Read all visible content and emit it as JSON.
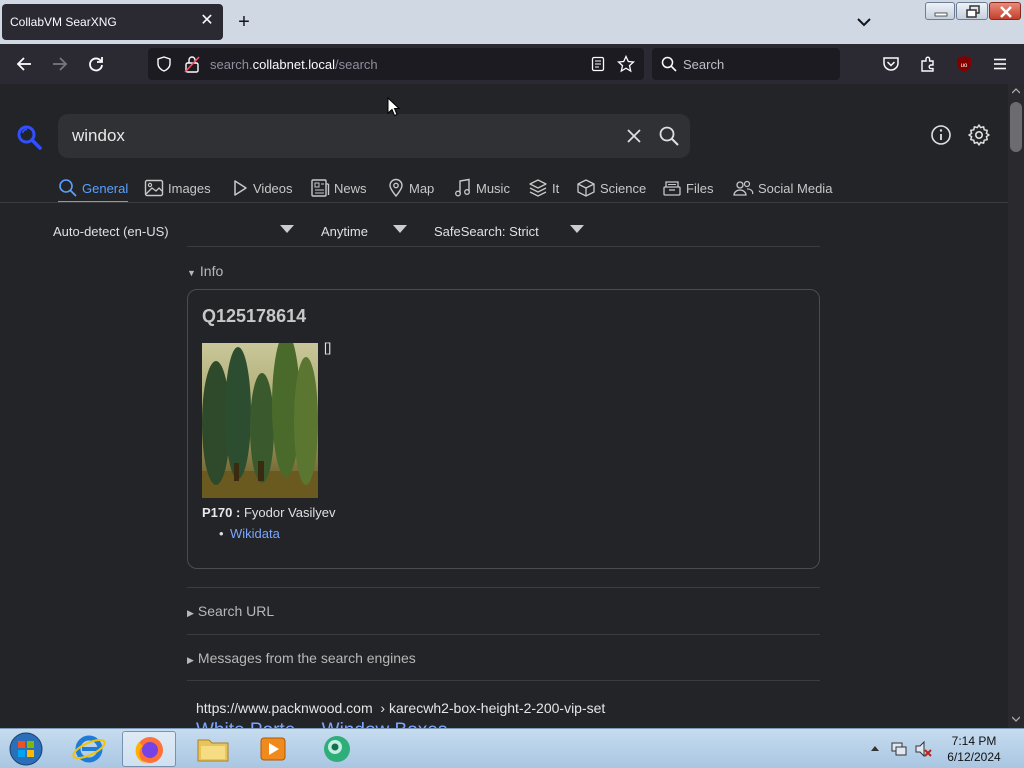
{
  "browser": {
    "tab_title": "CollabVM SearXNG",
    "url_prefix": "search.",
    "url_domain": "collabnet.local",
    "url_path": "/search",
    "search_placeholder": "Search"
  },
  "search": {
    "query": "windox"
  },
  "categories": [
    {
      "label": "General",
      "icon": "search-icon"
    },
    {
      "label": "Images",
      "icon": "image-icon"
    },
    {
      "label": "Videos",
      "icon": "play-icon"
    },
    {
      "label": "News",
      "icon": "newspaper-icon"
    },
    {
      "label": "Map",
      "icon": "map-pin-icon"
    },
    {
      "label": "Music",
      "icon": "music-note-icon"
    },
    {
      "label": "It",
      "icon": "layers-icon"
    },
    {
      "label": "Science",
      "icon": "cube-icon"
    },
    {
      "label": "Files",
      "icon": "file-tray-icon"
    },
    {
      "label": "Social Media",
      "icon": "people-icon"
    }
  ],
  "filters": {
    "language": "Auto-detect (en-US)",
    "time": "Anytime",
    "safesearch": "SafeSearch: Strict"
  },
  "infobox": {
    "section_label": "Info",
    "title": "Q125178614",
    "bracket": "[]",
    "attr_key": "P170 :",
    "attr_value": "Fyodor Vasilyev",
    "link": "Wikidata"
  },
  "sections": {
    "search_url": "Search URL",
    "messages": "Messages from the search engines"
  },
  "result": {
    "url_host": "https://www.packnwood.com",
    "url_path": "› karecwh2-box-height-2-200-vip-set",
    "title": "White Porte ... Window Boxes"
  },
  "taskbar": {
    "time": "7:14 PM",
    "date": "6/12/2024"
  },
  "colors": {
    "accent": "#5aa0ff",
    "link": "#7aa6ff",
    "page_bg": "#222428"
  }
}
